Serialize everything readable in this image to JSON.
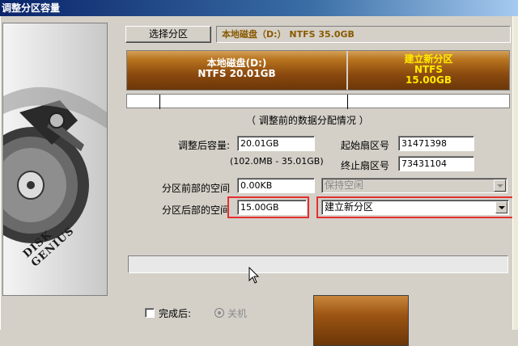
{
  "window": {
    "title": "调整分区容量"
  },
  "sidebar": {
    "brand_text": "DISK GENIUS"
  },
  "toolbar": {
    "select_partition_label": "选择分区",
    "disk_info": "本地磁盘（D:） NTFS 35.0GB"
  },
  "partitions": [
    {
      "name": "本地磁盘(D:)",
      "fs": "NTFS",
      "size": "NTFS 20.01GB",
      "color": "#8b4a0f",
      "text_color": "#ffffff"
    },
    {
      "name": "建立新分区",
      "fs": "NTFS",
      "size": "15.00GB",
      "color": "#8b4a0f",
      "text_color": "#ffea00"
    }
  ],
  "form": {
    "section_title": "（ 调整前的数据分配情况 ）",
    "new_size_label": "调整后容量:",
    "new_size_value": "20.01GB",
    "range_hint": "(102.0MB - 35.01GB)",
    "start_sector_label": "起始扇区号",
    "start_sector_value": "31471398",
    "end_sector_label": "终止扇区号",
    "end_sector_value": "73431104",
    "before_space_label": "分区前部的空间",
    "before_space_value": "0.00KB",
    "before_space_option": "保持空闲",
    "after_space_label": "分区后部的空间",
    "after_space_value": "15.00GB",
    "after_space_option": "建立新分区"
  },
  "footer": {
    "complete_label": "完成后:",
    "shutdown_label": "关机"
  },
  "colors": {
    "highlight_box": "#e23030",
    "partition_brown": "#8b4a0f"
  }
}
